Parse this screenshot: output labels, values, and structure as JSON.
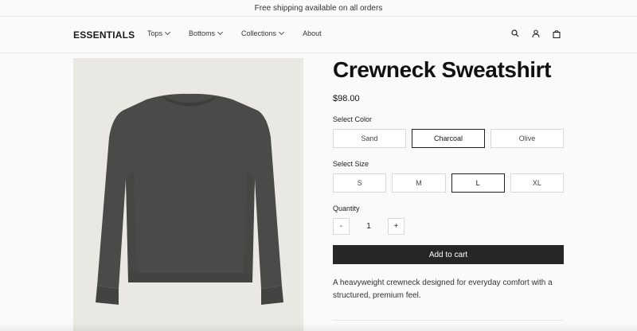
{
  "announcement": "Free shipping available on all orders",
  "header": {
    "logo": "ESSENTIALS",
    "nav": [
      {
        "label": "Tops"
      },
      {
        "label": "Bottoms"
      },
      {
        "label": "Collections"
      },
      {
        "label": "About"
      }
    ],
    "icons": [
      "search-icon",
      "account-icon",
      "cart-icon"
    ]
  },
  "product": {
    "title": "Crewneck Sweatshirt",
    "price": "$98.00",
    "color_label": "Select Color",
    "colors": [
      "Sand",
      "Charcoal",
      "Olive"
    ],
    "selected_color": "Charcoal",
    "size_label": "Select Size",
    "sizes": [
      "S",
      "M",
      "L",
      "XL"
    ],
    "selected_size": "L",
    "quantity_label": "Quantity",
    "quantity_minus": "-",
    "quantity": "1",
    "quantity_plus": "+",
    "add_to_cart": "Add to cart",
    "description": "A heavyweight crewneck designed for everyday comfort with a structured, premium feel.",
    "image_color": "#4a4b48",
    "image_background": "#eae8e2"
  },
  "colors": {
    "accent": "#262626",
    "border": "#d8d8d8",
    "selected_border": "#222222"
  }
}
